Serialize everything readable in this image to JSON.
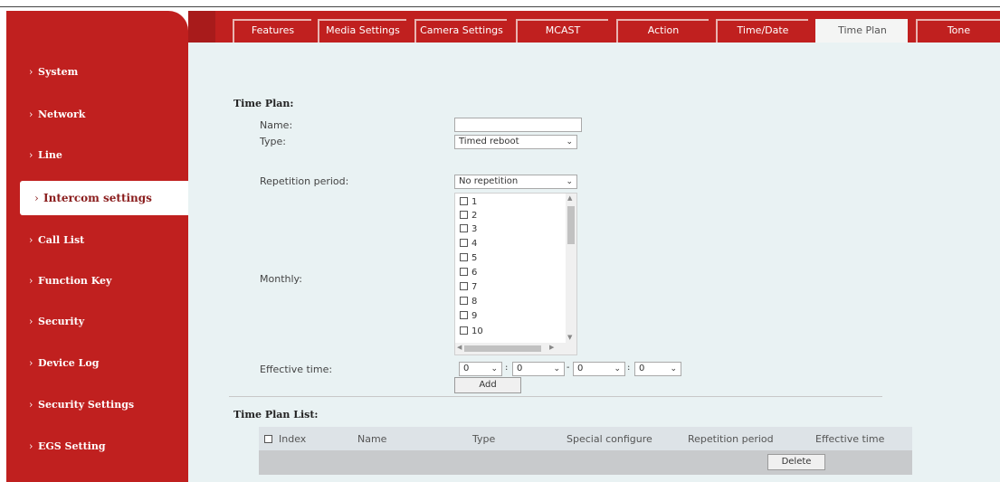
{
  "sidebar": {
    "items": [
      {
        "label": "System"
      },
      {
        "label": "Network"
      },
      {
        "label": "Line"
      },
      {
        "label": "Intercom settings",
        "active": true
      },
      {
        "label": "Call List"
      },
      {
        "label": "Function Key"
      },
      {
        "label": "Security"
      },
      {
        "label": "Device Log"
      },
      {
        "label": "Security Settings"
      },
      {
        "label": "EGS Setting"
      }
    ]
  },
  "tabs": [
    {
      "label": "Features"
    },
    {
      "label": "Media Settings"
    },
    {
      "label": "Camera Settings"
    },
    {
      "label": "MCAST"
    },
    {
      "label": "Action"
    },
    {
      "label": "Time/Date"
    },
    {
      "label": "Time Plan",
      "active": true
    },
    {
      "label": "Tone"
    }
  ],
  "form": {
    "section_title": "Time Plan:",
    "name_label": "Name:",
    "name_value": "",
    "type_label": "Type:",
    "type_value": "Timed reboot",
    "repetition_label": "Repetition period:",
    "repetition_value": "No repetition",
    "monthly_label": "Monthly:",
    "monthly_options": [
      "1",
      "2",
      "3",
      "4",
      "5",
      "6",
      "7",
      "8",
      "9",
      "10"
    ],
    "effective_label": "Effective time:",
    "time_values": [
      "0",
      "0",
      "0",
      "0"
    ],
    "time_separators": [
      ":",
      "-",
      ":"
    ],
    "add_label": "Add"
  },
  "list": {
    "section_title": "Time Plan List:",
    "columns": [
      "Index",
      "Name",
      "Type",
      "Special configure",
      "Repetition period",
      "Effective time"
    ],
    "delete_label": "Delete"
  },
  "colors": {
    "brand": "#c0201f",
    "content_bg": "#e9f2f3"
  }
}
